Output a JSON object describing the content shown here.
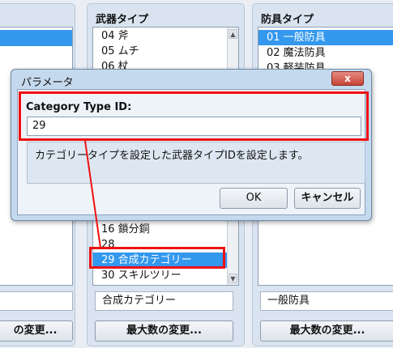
{
  "left_panel": {
    "change_max_button": "の変更..."
  },
  "weapon_panel": {
    "title": "武器タイプ",
    "items_top": [
      "04 斧",
      "05 ムチ",
      "06 杖"
    ],
    "items_bottom": [
      "16 鎖分銅",
      "28",
      "29 合成カテゴリー",
      "30 スキルツリー"
    ],
    "selected": "29 合成カテゴリー",
    "name_value": "合成カテゴリー",
    "change_max_button": "最大数の変更..."
  },
  "armor_panel": {
    "title": "防具タイプ",
    "items": [
      "01 一般防具",
      "02 魔法防具",
      "03 軽装防具"
    ],
    "selected": "01 一般防具",
    "name_value": "一般防具",
    "change_max_button": "最大数の変更..."
  },
  "dialog": {
    "title": "パラメータ",
    "close_label": "x",
    "param_label": "Category Type ID:",
    "param_value": "29",
    "description": "カテゴリータイプを設定した武器タイプIDを設定します。",
    "ok_label": "OK",
    "cancel_label": "キャンセル"
  },
  "colors": {
    "highlight": "#ee1111",
    "selection": "#3398ee"
  }
}
